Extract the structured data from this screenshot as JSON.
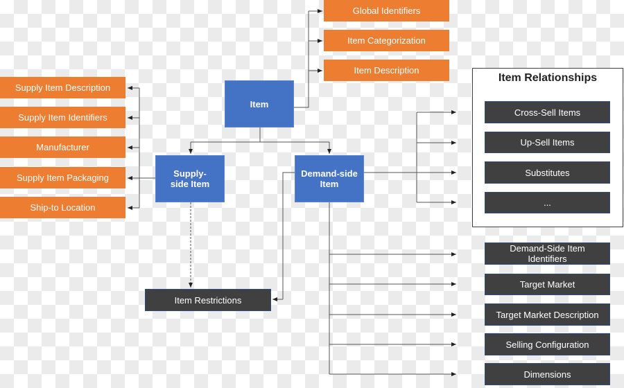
{
  "root": "Item",
  "global_items": [
    "Global Identifiers",
    "Item Categorization",
    "Item Description"
  ],
  "supply_items": [
    "Supply Item Description",
    "Supply Item Identifiers",
    "Manufacturer",
    "Supply Item Packaging",
    "Ship-to Location"
  ],
  "supply_side": "Supply-side Item",
  "demand_side": "Demand-side Item",
  "restrictions": "Item Restrictions",
  "relationships": {
    "title": "Item Relationships",
    "items": [
      "Cross-Sell Items",
      "Up-Sell Items",
      "Substitutes",
      "..."
    ]
  },
  "demand_items": [
    "Demand-Side Item Identifiers",
    "Target Market",
    "Target Market Description",
    "Selling Configuration",
    "Dimensions"
  ],
  "colors": {
    "orange": "#ed7d31",
    "blue": "#4472c4",
    "dark": "#404040"
  }
}
